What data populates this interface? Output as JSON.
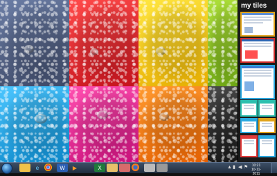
{
  "sidebar": {
    "title": "my tiles"
  },
  "taskbar": {
    "clock_time": "10:21",
    "clock_date": "10-11-2011",
    "items": [
      "start",
      "explorer",
      "ie",
      "chrome",
      "word",
      "media",
      "excel",
      "folder",
      "paint",
      "firefox",
      "tile-app",
      "app"
    ]
  },
  "colors": {
    "tiles": [
      "#4b5878",
      "#e0202a",
      "#f2c400",
      "#8dc421",
      "#0aa0e0",
      "#e0208f",
      "#f27a10",
      "#2a2a2a"
    ],
    "sidebar_bg": "#1a1a1a",
    "taskbar": "#2c3b52"
  }
}
